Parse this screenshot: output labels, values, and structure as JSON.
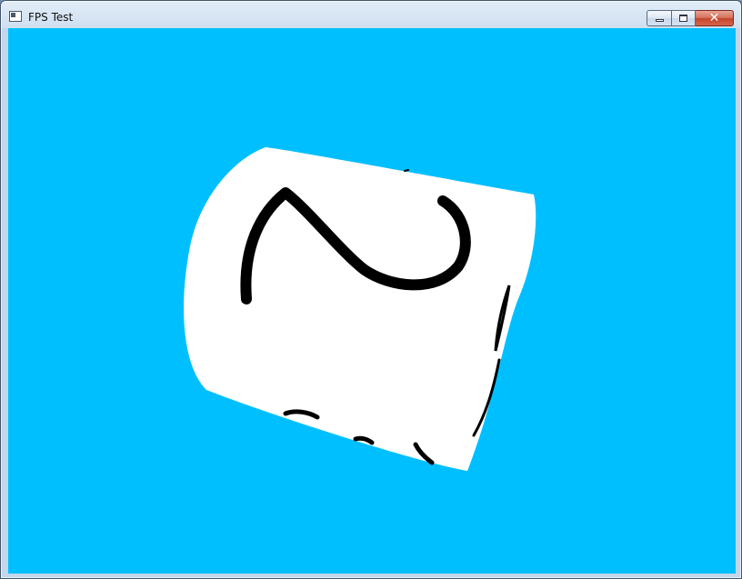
{
  "window": {
    "title": "FPS Test",
    "buttons": {
      "minimize_icon": "minimize-icon",
      "maximize_icon": "maximize-icon",
      "close_icon": "close-icon",
      "close_glyph": "✕"
    }
  },
  "scene": {
    "background_color": "#00bfff",
    "object_color": "#ffffff",
    "marking_color": "#000000",
    "front_face_marking": "2"
  }
}
